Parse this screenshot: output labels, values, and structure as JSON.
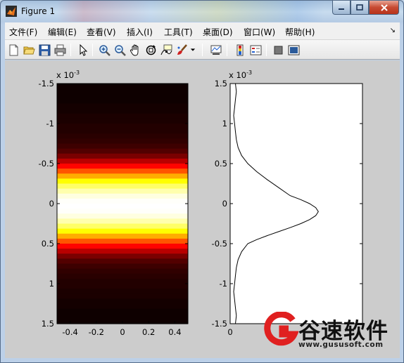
{
  "window": {
    "title": "Figure 1"
  },
  "menu": {
    "items": [
      {
        "label": "文件(F)"
      },
      {
        "label": "编辑(E)"
      },
      {
        "label": "查看(V)"
      },
      {
        "label": "插入(I)"
      },
      {
        "label": "工具(T)"
      },
      {
        "label": "桌面(D)"
      },
      {
        "label": "窗口(W)"
      },
      {
        "label": "帮助(H)"
      }
    ]
  },
  "toolbar": {
    "buttons": [
      "new-figure",
      "open-file",
      "save",
      "print",
      "edit-plot",
      "zoom-in",
      "zoom-out",
      "pan",
      "rotate-3d",
      "data-cursor",
      "brush",
      "link-plot",
      "insert-colorbar",
      "insert-legend",
      "hide-plot-tools",
      "show-plot-tools"
    ]
  },
  "chart_data": [
    {
      "type": "heatmap",
      "exponent_label": "x 10",
      "exponent_power": "-3",
      "colormap": "hot",
      "y_ticks": [
        "-1.5",
        "-1",
        "-0.5",
        "0",
        "0.5",
        "1",
        "1.5"
      ],
      "x_ticks": [
        "-0.4",
        "-0.2",
        "0",
        "0.2",
        "0.4"
      ],
      "ylim": [
        -1.5,
        1.5
      ],
      "xlim": [
        -0.5,
        0.5
      ],
      "y_direction": "reverse",
      "grid": false,
      "levels": [
        0.02,
        0.02,
        0.02,
        0.02,
        0.03,
        0.03,
        0.04,
        0.04,
        0.05,
        0.05,
        0.06,
        0.07,
        0.09,
        0.12,
        0.18,
        0.27,
        0.38,
        0.5,
        0.63,
        0.75,
        0.85,
        0.92,
        0.97,
        0.995,
        1.0,
        0.995,
        0.97,
        0.92,
        0.85,
        0.75,
        0.63,
        0.5,
        0.38,
        0.27,
        0.18,
        0.12,
        0.09,
        0.07,
        0.06,
        0.05,
        0.05,
        0.04,
        0.04,
        0.03,
        0.03,
        0.02,
        0.02,
        0.02
      ]
    },
    {
      "type": "line",
      "exponent_label": "x 10",
      "exponent_power": "-3",
      "y_ticks": [
        "1.5",
        "1",
        "0.5",
        "0",
        "-0.5",
        "-1",
        "-1.5"
      ],
      "x_ticks": [
        "0"
      ],
      "ylim": [
        -1.5,
        1.5
      ],
      "xlim": [
        0,
        1.5
      ],
      "grid": false,
      "series": [
        {
          "x": [
            0.06,
            0.07,
            0.06,
            0.05,
            0.04,
            0.05,
            0.06,
            0.07,
            0.09,
            0.13,
            0.2,
            0.3,
            0.42,
            0.55,
            0.68,
            0.8,
            0.9,
            0.97,
            1.0,
            0.97,
            0.9,
            0.8,
            0.68,
            0.55,
            0.42,
            0.3,
            0.2,
            0.13,
            0.09,
            0.07,
            0.06,
            0.05,
            0.04,
            0.05,
            0.06,
            0.07,
            0.06
          ],
          "y": [
            1.5,
            1.4,
            1.3,
            1.2,
            1.1,
            1.0,
            0.9,
            0.8,
            0.7,
            0.6,
            0.5,
            0.4,
            0.3,
            0.2,
            0.1,
            0.05,
            0.0,
            -0.05,
            -0.1,
            -0.15,
            -0.2,
            -0.25,
            -0.3,
            -0.35,
            -0.4,
            -0.45,
            -0.5,
            -0.6,
            -0.7,
            -0.8,
            -0.9,
            -1.0,
            -1.1,
            -1.2,
            -1.3,
            -1.4,
            -1.5
          ]
        }
      ]
    }
  ],
  "watermark": {
    "text": "谷速软件",
    "url": "www.gususoft.com"
  }
}
